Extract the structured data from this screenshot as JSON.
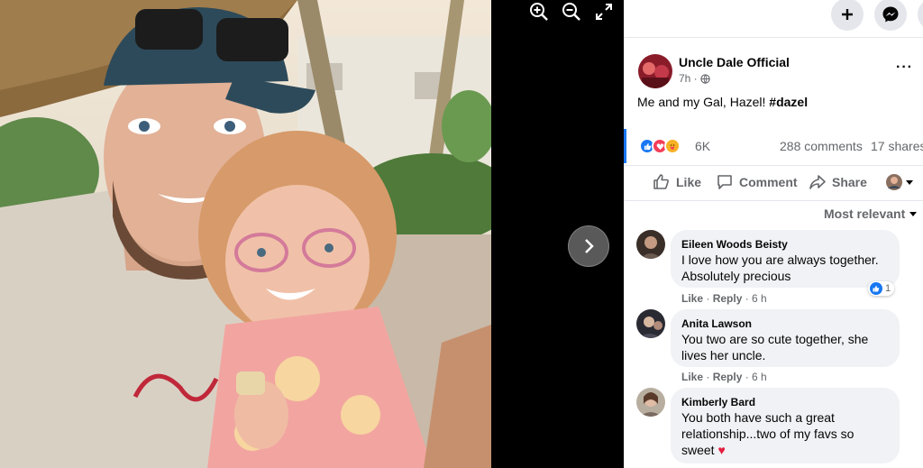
{
  "viewer": {
    "tools": [
      {
        "icon": "zoom-in-icon"
      },
      {
        "icon": "zoom-out-icon"
      },
      {
        "icon": "fullscreen-icon"
      }
    ],
    "next_icon": "chevron-right-icon"
  },
  "topbar": {
    "create_icon": "plus-icon",
    "messenger_icon": "messenger-icon"
  },
  "post": {
    "page_name": "Uncle Dale Official",
    "time": "7h ·",
    "privacy_icon": "globe-icon",
    "more": "···",
    "caption_text": "Me and my Gal, Hazel! ",
    "caption_tag": "#dazel",
    "reaction_icons": [
      "like-icon",
      "love-icon",
      "care-icon"
    ],
    "reaction_count": "6K",
    "comments": "288 comments",
    "shares": "17 shares"
  },
  "actions": {
    "like": "Like",
    "comment": "Comment",
    "share": "Share"
  },
  "sort_label": "Most relevant",
  "comments": [
    {
      "name": "Eileen Woods Beisty",
      "lines": [
        "I love how you are always together.",
        "Absolutely precious"
      ],
      "like": "Like",
      "reply": "Reply",
      "time": "6 h",
      "like_count": "1"
    },
    {
      "name": "Anita Lawson",
      "lines": [
        "You two are so cute together, she",
        "lives her uncle."
      ],
      "like": "Like",
      "reply": "Reply",
      "time": "6 h"
    },
    {
      "name": "Kimberly Bard",
      "lines": [
        "You both have such a great",
        "relationship...two of my favs so",
        "sweet "
      ],
      "heart": "♥"
    }
  ],
  "colors": {
    "facebook_blue": "#1877f2",
    "comment_bubble": "#f0f2f5",
    "secondary_text": "#65676b",
    "heart_red": "#e41e3f"
  }
}
